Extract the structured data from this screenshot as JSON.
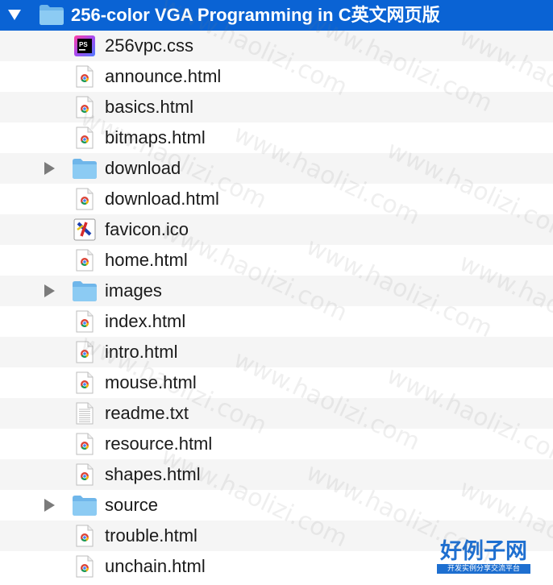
{
  "root": {
    "label": "256-color VGA Programming in C英文网页版",
    "expanded": true
  },
  "items": [
    {
      "label": "256vpc.css",
      "kind": "css",
      "icon": "phpstorm-file-icon"
    },
    {
      "label": "announce.html",
      "kind": "html",
      "icon": "chrome-html-file-icon"
    },
    {
      "label": "basics.html",
      "kind": "html",
      "icon": "chrome-html-file-icon"
    },
    {
      "label": "bitmaps.html",
      "kind": "html",
      "icon": "chrome-html-file-icon"
    },
    {
      "label": "download",
      "kind": "folder",
      "icon": "folder-icon"
    },
    {
      "label": "download.html",
      "kind": "html",
      "icon": "chrome-html-file-icon"
    },
    {
      "label": "favicon.ico",
      "kind": "ico",
      "icon": "ico-file-icon"
    },
    {
      "label": "home.html",
      "kind": "html",
      "icon": "chrome-html-file-icon"
    },
    {
      "label": "images",
      "kind": "folder",
      "icon": "folder-icon"
    },
    {
      "label": "index.html",
      "kind": "html",
      "icon": "chrome-html-file-icon"
    },
    {
      "label": "intro.html",
      "kind": "html",
      "icon": "chrome-html-file-icon"
    },
    {
      "label": "mouse.html",
      "kind": "html",
      "icon": "chrome-html-file-icon"
    },
    {
      "label": "readme.txt",
      "kind": "txt",
      "icon": "text-file-icon"
    },
    {
      "label": "resource.html",
      "kind": "html",
      "icon": "chrome-html-file-icon"
    },
    {
      "label": "shapes.html",
      "kind": "html",
      "icon": "chrome-html-file-icon"
    },
    {
      "label": "source",
      "kind": "folder",
      "icon": "folder-icon"
    },
    {
      "label": "trouble.html",
      "kind": "html",
      "icon": "chrome-html-file-icon"
    },
    {
      "label": "unchain.html",
      "kind": "html",
      "icon": "chrome-html-file-icon"
    }
  ],
  "watermark": {
    "text": "www.haolizi.com",
    "brand_big": "好例子网",
    "brand_small": "开发实例分享交流平台"
  },
  "colors": {
    "selection": "#0a63d4",
    "folder": "#7fc1f0",
    "stripe": "#f5f5f5"
  }
}
